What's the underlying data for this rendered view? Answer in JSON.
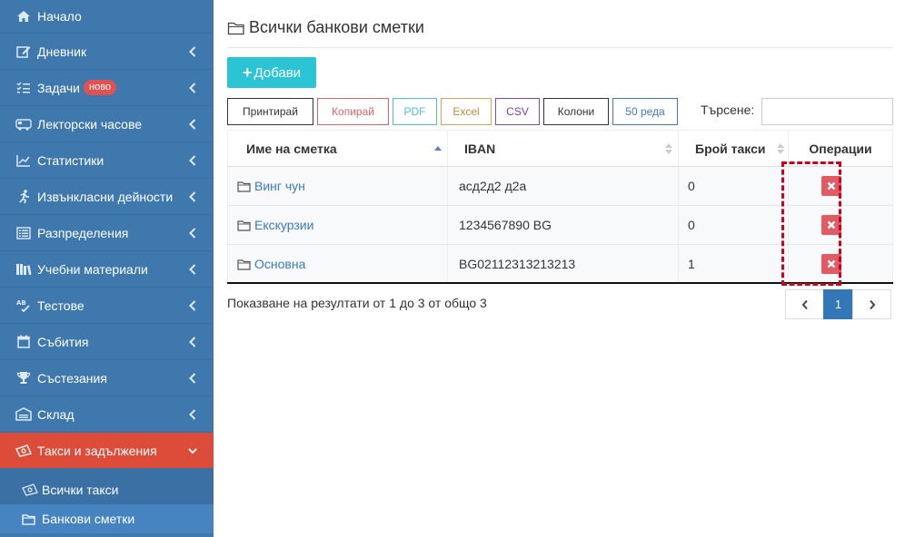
{
  "sidebar": {
    "items": [
      {
        "label": "Начало",
        "icon": "home-icon"
      },
      {
        "label": "Дневник",
        "icon": "edit-icon"
      },
      {
        "label": "Задачи",
        "icon": "tasks-icon",
        "badge": "ново"
      },
      {
        "label": "Лекторски часове",
        "icon": "bus-icon"
      },
      {
        "label": "Статистики",
        "icon": "chart-line-icon"
      },
      {
        "label": "Извънкласни дейности",
        "icon": "running-icon"
      },
      {
        "label": "Разпределения",
        "icon": "list-icon"
      },
      {
        "label": "Учебни материали",
        "icon": "books-icon"
      },
      {
        "label": "Тестове",
        "icon": "spellcheck-icon"
      },
      {
        "label": "Събития",
        "icon": "calendar-icon"
      },
      {
        "label": "Състезания",
        "icon": "trophy-icon"
      },
      {
        "label": "Склад",
        "icon": "warehouse-icon"
      },
      {
        "label": "Такси и задължения",
        "icon": "money-icon"
      }
    ],
    "sub_items": [
      {
        "label": "Всички такси",
        "icon": "money-icon"
      },
      {
        "label": "Банкови сметки",
        "icon": "folder-icon"
      }
    ],
    "colors": {
      "bg": "#3f78ad",
      "active": "#dd4b39"
    }
  },
  "main": {
    "title": "Всички банкови сметки",
    "add_button": "Добави",
    "toolbar": {
      "print": "Принтирай",
      "copy": "Копирай",
      "pdf": "PDF",
      "excel": "Excel",
      "csv": "CSV",
      "columns": "Колони",
      "rows": "50 реда"
    },
    "search": {
      "label": "Търсене:",
      "placeholder": ""
    },
    "table": {
      "headers": [
        "Име на сметка",
        "IBAN",
        "Брой такси",
        "Операции"
      ],
      "rows": [
        {
          "name": "Винг чун",
          "iban": "асд2д2 д2а",
          "count": "0"
        },
        {
          "name": "Екскурзии",
          "iban": "1234567890 BG",
          "count": "0"
        },
        {
          "name": "Основна",
          "iban": "BG02112313213213",
          "count": "1"
        }
      ]
    },
    "info": "Показване на резултати от 1 до 3 от общо 3",
    "pagination": {
      "current": "1"
    }
  }
}
